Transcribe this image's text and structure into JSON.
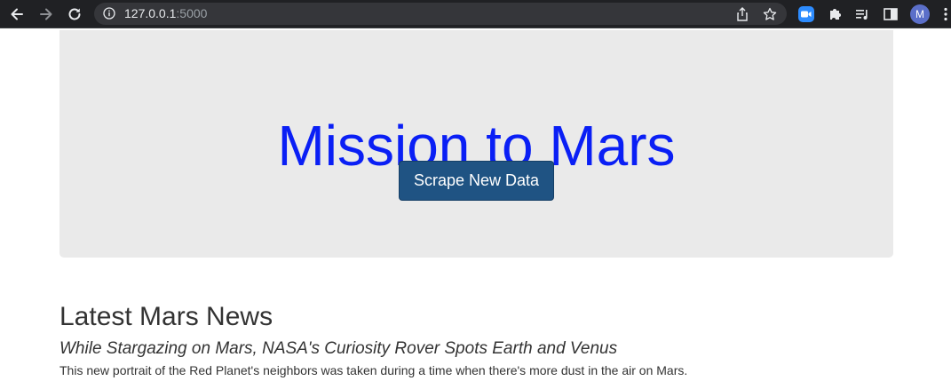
{
  "browser": {
    "url_host": "127.0.0.1",
    "url_port": ":5000",
    "profile_initial": "M",
    "icons": [
      "back-arrow-icon",
      "forward-arrow-icon",
      "reload-icon",
      "info-icon",
      "share-icon",
      "bookmark-star-icon",
      "zoom-extension-icon",
      "extensions-puzzle-icon",
      "media-queue-icon",
      "side-panel-icon",
      "more-menu-icon"
    ]
  },
  "hero": {
    "title": "Mission to Mars",
    "button_label": "Scrape New Data",
    "title_color": "#0a1ff5",
    "button_color": "#1f5383"
  },
  "news": {
    "heading": "Latest Mars News",
    "title": "While Stargazing on Mars, NASA's Curiosity Rover Spots Earth and Venus",
    "paragraph": "This new portrait of the Red Planet's neighbors was taken during a time when there's more dust in the air on Mars."
  }
}
